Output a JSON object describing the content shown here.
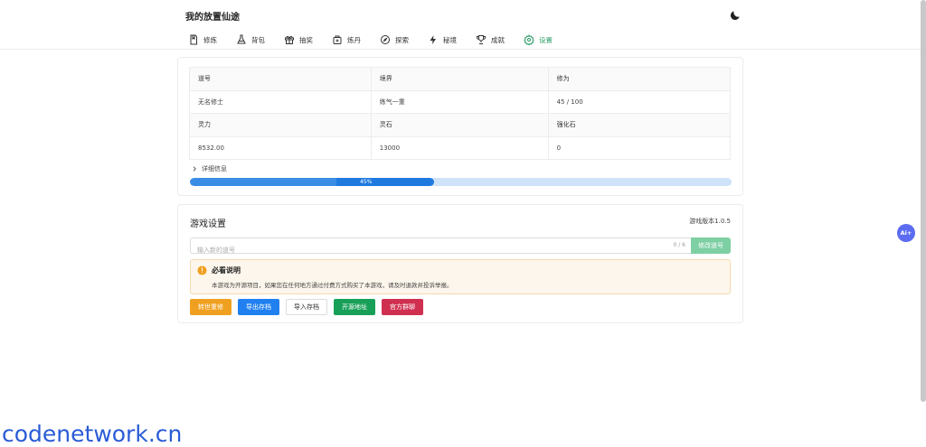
{
  "header": {
    "title": "我的放置仙途",
    "theme_icon": "moon-icon"
  },
  "tabs": [
    {
      "label": "修炼",
      "icon": "book-icon"
    },
    {
      "label": "背包",
      "icon": "flask-icon"
    },
    {
      "label": "抽奖",
      "icon": "gift-icon"
    },
    {
      "label": "炼丹",
      "icon": "cauldron-icon"
    },
    {
      "label": "探索",
      "icon": "compass-icon"
    },
    {
      "label": "秘境",
      "icon": "lightning-icon"
    },
    {
      "label": "成就",
      "icon": "trophy-icon"
    },
    {
      "label": "设置",
      "icon": "gear-icon",
      "active": true
    }
  ],
  "stats": {
    "headers_row1": [
      "道号",
      "境界",
      "修为"
    ],
    "values_row1": [
      "无名修士",
      "练气一重",
      "45 / 100"
    ],
    "headers_row2": [
      "灵力",
      "灵石",
      "强化石"
    ],
    "values_row2": [
      "8532.00",
      "13000",
      "0"
    ]
  },
  "details_label": "详细信息",
  "progress": {
    "percent": 45,
    "label": "45%"
  },
  "settings": {
    "title": "游戏设置",
    "version": "游戏版本1.0.5",
    "name_placeholder": "输入新的道号",
    "char_count": "0 / 6",
    "rename_label": "修改道号"
  },
  "notice": {
    "title": "必看说明",
    "text": "本游戏为开源项目，如果您在任何地方通过付费方式购买了本游戏，请及时退款并投诉举报。"
  },
  "buttons": {
    "reincarnate": "转世重修",
    "export": "导出存档",
    "import": "导入存档",
    "open_source": "开源地址",
    "group": "官方群聊"
  },
  "ai_fab": "Ai+",
  "watermark": "codenetwork.cn",
  "colors": {
    "accent_green": "#2f9e6a",
    "progress_blue": "#2080f0",
    "warning": "#f0a020",
    "danger": "#d03050",
    "ai": "#5b6cf0"
  }
}
